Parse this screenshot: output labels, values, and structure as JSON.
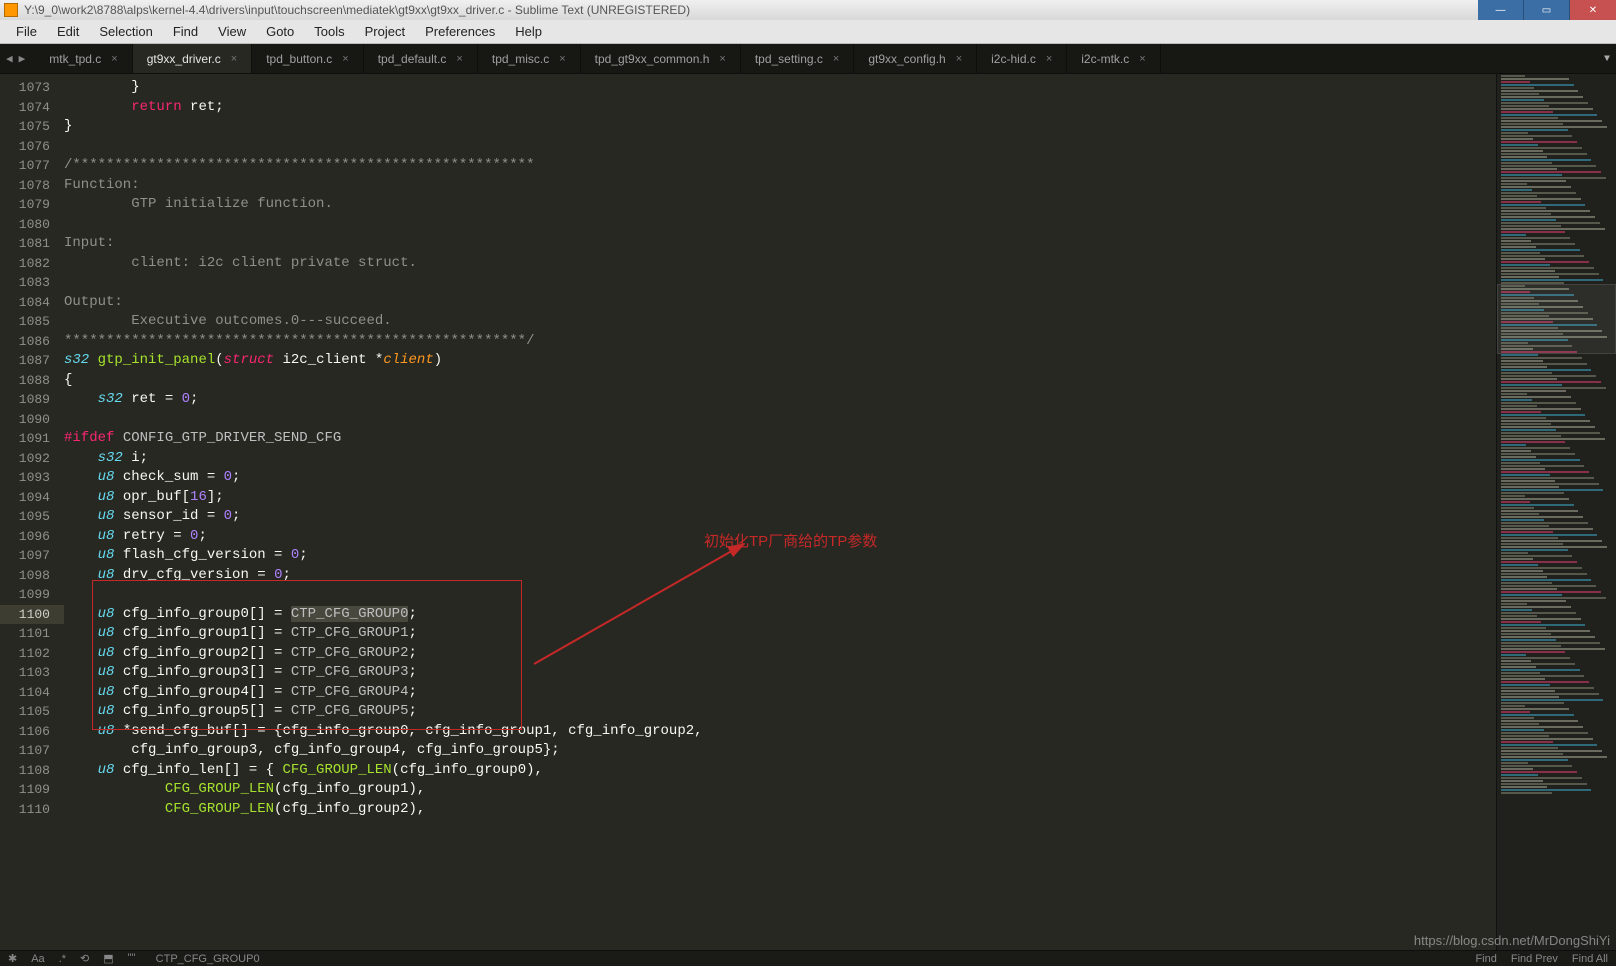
{
  "window": {
    "title": "Y:\\9_0\\work2\\8788\\alps\\kernel-4.4\\drivers\\input\\touchscreen\\mediatek\\gt9xx\\gt9xx_driver.c - Sublime Text (UNREGISTERED)"
  },
  "menubar": [
    "File",
    "Edit",
    "Selection",
    "Find",
    "View",
    "Goto",
    "Tools",
    "Project",
    "Preferences",
    "Help"
  ],
  "tabs": [
    {
      "label": "mtk_tpd.c",
      "active": false
    },
    {
      "label": "gt9xx_driver.c",
      "active": true
    },
    {
      "label": "tpd_button.c",
      "active": false
    },
    {
      "label": "tpd_default.c",
      "active": false
    },
    {
      "label": "tpd_misc.c",
      "active": false
    },
    {
      "label": "tpd_gt9xx_common.h",
      "active": false
    },
    {
      "label": "tpd_setting.c",
      "active": false
    },
    {
      "label": "gt9xx_config.h",
      "active": false
    },
    {
      "label": "i2c-hid.c",
      "active": false
    },
    {
      "label": "i2c-mtk.c",
      "active": false
    }
  ],
  "line_start": 1073,
  "line_end": 1110,
  "current_line": 1100,
  "code": {
    "l1073": {
      "indent": "        ",
      "t": "}"
    },
    "l1074": {
      "indent": "        ",
      "kw": "return",
      "after": " ret;"
    },
    "l1075": {
      "indent": "",
      "t": "}"
    },
    "l1076": {
      "indent": "",
      "t": ""
    },
    "l1077": {
      "indent": "",
      "cm": "/*******************************************************"
    },
    "l1078": {
      "indent": "",
      "cm": "Function:"
    },
    "l1079": {
      "indent": "        ",
      "cm": "GTP initialize function."
    },
    "l1080": {
      "indent": "",
      "cm": ""
    },
    "l1081": {
      "indent": "",
      "cm": "Input:"
    },
    "l1082": {
      "indent": "        ",
      "cm": "client: i2c client private struct."
    },
    "l1083": {
      "indent": "",
      "cm": ""
    },
    "l1084": {
      "indent": "",
      "cm": "Output:"
    },
    "l1085": {
      "indent": "        ",
      "cm": "Executive outcomes.0---succeed."
    },
    "l1086": {
      "indent": "",
      "cm": "*******************************************************/"
    },
    "l1087": {
      "ty1": "s32",
      "sp1": " ",
      "fn": "gtp_init_panel",
      "op": "(",
      "kw": "struct",
      "sp2": " ",
      "ty2": "i2c_client",
      "sp3": " *",
      "param": "client",
      "cp": ")"
    },
    "l1088": {
      "indent": "",
      "t": "{"
    },
    "l1089": {
      "indent": "    ",
      "ty": "s32",
      "after": " ret = ",
      "num": "0",
      "end": ";"
    },
    "l1090": {
      "indent": "",
      "t": ""
    },
    "l1091": {
      "pp": "#ifdef",
      "sp": " ",
      "name": "CONFIG_GTP_DRIVER_SEND_CFG"
    },
    "l1092": {
      "indent": "    ",
      "ty": "s32",
      "after": " i;"
    },
    "l1093": {
      "indent": "    ",
      "ty": "u8",
      "after": " check_sum = ",
      "num": "0",
      "end": ";"
    },
    "l1094": {
      "indent": "    ",
      "ty": "u8",
      "after": " opr_buf[",
      "num": "16",
      "end": "];"
    },
    "l1095": {
      "indent": "    ",
      "ty": "u8",
      "after": " sensor_id = ",
      "num": "0",
      "end": ";"
    },
    "l1096": {
      "indent": "    ",
      "ty": "u8",
      "after": " retry = ",
      "num": "0",
      "end": ";"
    },
    "l1097": {
      "indent": "    ",
      "ty": "u8",
      "after": " flash_cfg_version = ",
      "num": "0",
      "end": ";"
    },
    "l1098": {
      "indent": "    ",
      "ty": "u8",
      "after": " drv_cfg_version = ",
      "num": "0",
      "end": ";"
    },
    "l1099": {
      "indent": "",
      "t": ""
    },
    "l1100": {
      "indent": "    ",
      "ty": "u8",
      "mid": " cfg_info_group0[] = ",
      "sel": "CTP_CFG_GROUP0",
      "end": ";"
    },
    "l1101": {
      "indent": "    ",
      "ty": "u8",
      "mid": " cfg_info_group1[] = ",
      "c": "CTP_CFG_GROUP1",
      "end": ";"
    },
    "l1102": {
      "indent": "    ",
      "ty": "u8",
      "mid": " cfg_info_group2[] = ",
      "c": "CTP_CFG_GROUP2",
      "end": ";"
    },
    "l1103": {
      "indent": "    ",
      "ty": "u8",
      "mid": " cfg_info_group3[] = ",
      "c": "CTP_CFG_GROUP3",
      "end": ";"
    },
    "l1104": {
      "indent": "    ",
      "ty": "u8",
      "mid": " cfg_info_group4[] = ",
      "c": "CTP_CFG_GROUP4",
      "end": ";"
    },
    "l1105": {
      "indent": "    ",
      "ty": "u8",
      "mid": " cfg_info_group5[] = ",
      "c": "CTP_CFG_GROUP5",
      "end": ";"
    },
    "l1106": {
      "indent": "    ",
      "ty": "u8",
      "after": " *send_cfg_buf[] = {cfg_info_group0, cfg_info_group1, cfg_info_group2,"
    },
    "l1107": {
      "indent": "        ",
      "t": "cfg_info_group3, cfg_info_group4, cfg_info_group5};"
    },
    "l1108": {
      "indent": "    ",
      "ty": "u8",
      "mid": " cfg_info_len[] = { ",
      "fn": "CFG_GROUP_LEN",
      "after2": "(cfg_info_group0),"
    },
    "l1109": {
      "indent": "            ",
      "fn": "CFG_GROUP_LEN",
      "after": "(cfg_info_group1),"
    },
    "l1110": {
      "indent": "            ",
      "fn": "CFG_GROUP_LEN",
      "after": "(cfg_info_group2),"
    }
  },
  "annotation": "初始化TP厂商给的TP参数",
  "statusbar": {
    "find": "Find",
    "find_prev": "Find Prev",
    "find_all": "Find All",
    "selection_hint": "CTP_CFG_GROUP0"
  },
  "watermark": "https://blog.csdn.net/MrDongShiYi",
  "tab_close_glyph": "×",
  "nav_prev": "◀",
  "nav_next": "▶",
  "overflow_glyph": "▼",
  "win_min": "—",
  "win_max": "▭",
  "win_close": "✕"
}
